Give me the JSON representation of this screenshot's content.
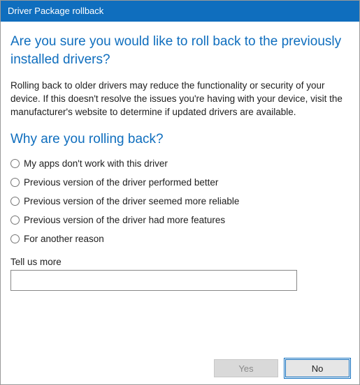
{
  "window": {
    "title": "Driver Package rollback"
  },
  "heading": "Are you sure you would like to roll back to the previously installed drivers?",
  "body_text": "Rolling back to older drivers may reduce the functionality or security of your device.  If this doesn't resolve the issues you're having with your device, visit the manufacturer's website to determine if updated drivers are available.",
  "subheading": "Why are you rolling back?",
  "reasons": [
    "My apps don't work with this driver",
    "Previous version of the driver performed better",
    "Previous version of the driver seemed more reliable",
    "Previous version of the driver had more features",
    "For another reason"
  ],
  "tell_us_more": {
    "label": "Tell us more",
    "value": ""
  },
  "buttons": {
    "yes": "Yes",
    "no": "No"
  }
}
